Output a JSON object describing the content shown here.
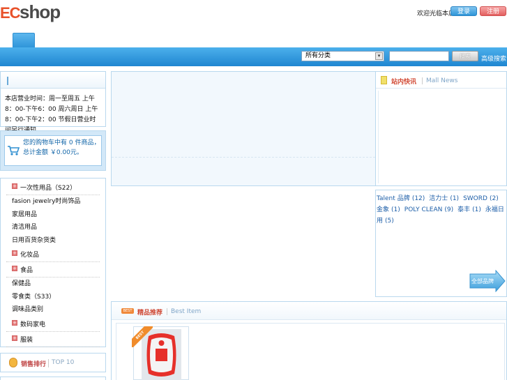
{
  "header": {
    "logo_ec": "EC",
    "logo_shop": "shop",
    "welcome": "欢迎光临本店",
    "login_label": "登录",
    "register_label": "注册"
  },
  "search": {
    "category_value": "所有分类",
    "button_label": "搜索",
    "advanced_label": "高级搜索"
  },
  "notice": {
    "text": "本店营业时间：周一至周五 上午8：00-下午6：00 周六周日 上午8：00-下午2：00 节假日营业时间另行通知。"
  },
  "cart": {
    "text": "您的购物车中有 0 件商品，总计金额 ￥0.00元。"
  },
  "categories": [
    {
      "label": "一次性用品（S22）",
      "top": true
    },
    {
      "label": "fasion jewelry时尚饰品",
      "top": false
    },
    {
      "label": "家居用品",
      "top": false
    },
    {
      "label": "清洁用品",
      "top": false
    },
    {
      "label": "日用百货杂货类",
      "top": false
    },
    {
      "label": "化妆品",
      "top": true
    },
    {
      "label": "食品",
      "top": true
    },
    {
      "label": "保健品",
      "top": false
    },
    {
      "label": "零食类（S33）",
      "top": false
    },
    {
      "label": "调味品类别",
      "top": false
    },
    {
      "label": "数码家电",
      "top": true
    },
    {
      "label": "服装",
      "top": true
    }
  ],
  "ranking": {
    "title": "销售排行",
    "subtitle": "TOP 10"
  },
  "news": {
    "title": "站内快讯",
    "subtitle": "Mall News"
  },
  "brands": {
    "items": [
      {
        "name": "Talent",
        "extra": "品牌",
        "count": "(12)"
      },
      {
        "name": "洁力士",
        "extra": "",
        "count": "(1)"
      },
      {
        "name": "SWORD",
        "extra": "",
        "count": "(2)"
      },
      {
        "name": "金象",
        "extra": "",
        "count": "(1)"
      },
      {
        "name": "POLY CLEAN",
        "extra": "",
        "count": "(9)"
      },
      {
        "name": "泰丰",
        "extra": "",
        "count": "(1)"
      },
      {
        "name": "永福日用",
        "extra": "",
        "count": "(5)"
      }
    ],
    "more_label": "全部品牌"
  },
  "best": {
    "tag": "BEST",
    "title": "精品推荐",
    "subtitle": "Best Item",
    "product_ribbon": "BEST"
  },
  "colors": {
    "nav_blue": "#1f86d1",
    "accent_red": "#d24b36",
    "link_blue": "#1c5ea8",
    "panel_border": "#b9d8ee"
  }
}
